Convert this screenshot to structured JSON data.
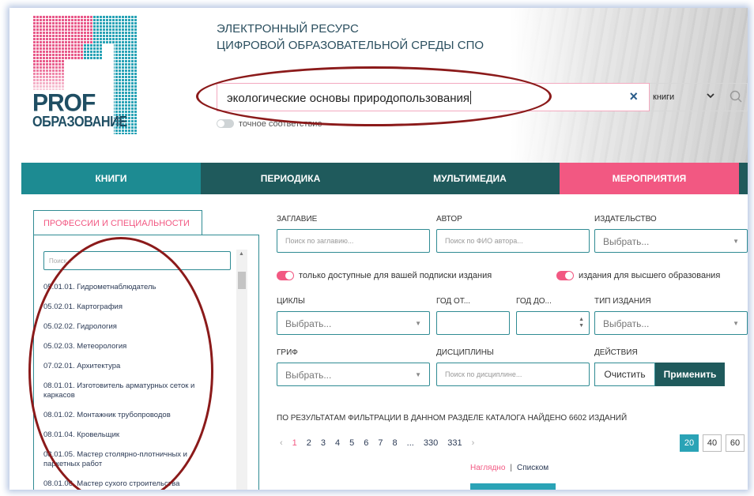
{
  "header": {
    "logo_line1": "PROF",
    "logo_line2": "ОБРАЗОВАНИЕ",
    "title_line1": "ЭЛЕКТРОННЫЙ РЕСУРС",
    "title_line2": "ЦИФРОВОЙ ОБРАЗОВАТЕЛЬНОЙ СРЕДЫ СПО"
  },
  "search": {
    "value": "экологические основы природопользования",
    "clear_icon": "×",
    "type_value": "книги",
    "exact_label": "точное соответствие"
  },
  "nav": {
    "items": [
      "Книги",
      "Периодика",
      "Мультимедиа",
      "Мероприятия"
    ]
  },
  "sidebar": {
    "tab_label": "Профессии и специальности",
    "search_placeholder": "Поиск...",
    "items": [
      "05.01.01. Гидрометнаблюдатель",
      "05.02.01. Картография",
      "05.02.02. Гидрология",
      "05.02.03. Метеорология",
      "07.02.01. Архитектура",
      "08.01.01. Изготовитель арматурных сеток и каркасов",
      "08.01.02. Монтажник трубопроводов",
      "08.01.04. Кровельщик",
      "08.01.05. Мастер столярно-плотничных и паркетных работ",
      "08.01.06. Мастер сухого строительства"
    ]
  },
  "filters": {
    "title_label": "Заглавие",
    "title_placeholder": "Поиск по заглавию...",
    "author_label": "Автор",
    "author_placeholder": "Поиск по ФИО автора...",
    "publisher_label": "Издательство",
    "publisher_placeholder": "Выбрать...",
    "toggle_subscription": "только доступные для вашей подписки издания",
    "toggle_higher": "издания для высшего образования",
    "cycles_label": "Циклы",
    "cycles_placeholder": "Выбрать...",
    "year_from_label": "Год от...",
    "year_to_label": "Год до...",
    "pubtype_label": "Тип издания",
    "pubtype_placeholder": "Выбрать...",
    "grif_label": "Гриф",
    "grif_placeholder": "Выбрать...",
    "disciplines_label": "Дисциплины",
    "disciplines_placeholder": "Поиск по дисциплине...",
    "actions_label": "Действия",
    "clear_button": "Очистить",
    "apply_button": "Применить"
  },
  "results": {
    "text": "По результатам фильтрации в данном разделе каталога найдено 6602 изданий"
  },
  "pagination": {
    "prev": "‹",
    "pages": [
      "1",
      "2",
      "3",
      "4",
      "5",
      "6",
      "7",
      "8",
      "...",
      "330",
      "331"
    ],
    "next": "›",
    "page_sizes": [
      "20",
      "40",
      "60"
    ]
  },
  "view": {
    "visual": "Наглядно",
    "separator": "|",
    "list": "Списком"
  }
}
